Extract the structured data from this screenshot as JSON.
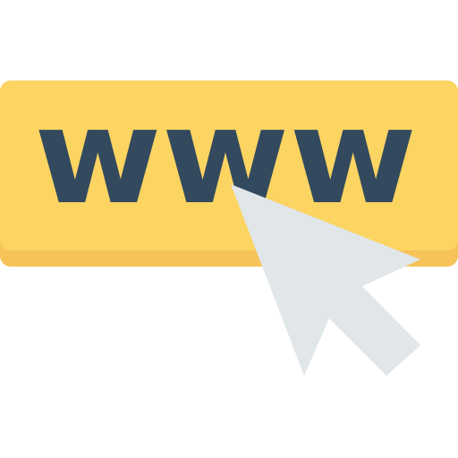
{
  "button": {
    "label": "www"
  },
  "icons": {
    "cursor": "mouse-pointer-arrow-icon"
  },
  "colors": {
    "button_face": "#FCD462",
    "button_shadow": "#F6C358",
    "text": "#334A5E",
    "cursor_fill": "#E1E6E9"
  }
}
